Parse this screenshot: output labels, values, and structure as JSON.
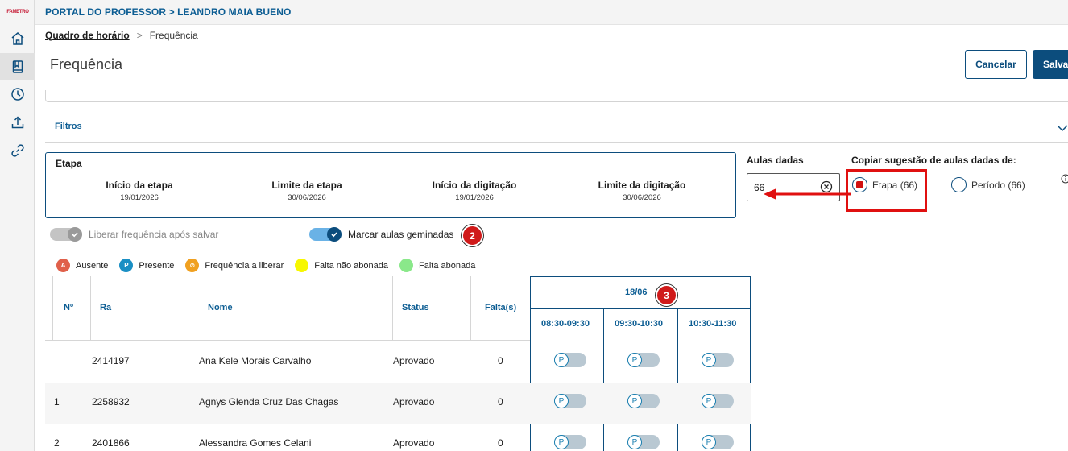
{
  "app": {
    "logo_text": "FAMETRO",
    "header_title": "PORTAL DO PROFESSOR > LEANDRO MAIA BUENO"
  },
  "sidebar": {
    "items": [
      {
        "name": "home-icon",
        "active": false
      },
      {
        "name": "book-icon",
        "active": true
      },
      {
        "name": "clock-icon",
        "active": false
      },
      {
        "name": "upload-icon",
        "active": false
      },
      {
        "name": "link-icon",
        "active": false
      }
    ]
  },
  "breadcrumb": {
    "link": "Quadro de horário",
    "separator": ">",
    "current": "Frequência"
  },
  "page": {
    "title": "Frequência",
    "cancel_label": "Cancelar",
    "save_label": "Salva"
  },
  "filters": {
    "label": "Filtros"
  },
  "etapa": {
    "title": "Etapa",
    "columns": [
      {
        "label": "Início da etapa",
        "value": "19/01/2026"
      },
      {
        "label": "Limite da etapa",
        "value": "30/06/2026"
      },
      {
        "label": "Início da digitação",
        "value": "19/01/2026"
      },
      {
        "label": "Limite da digitação",
        "value": "30/06/2026"
      }
    ]
  },
  "aulas_dadas": {
    "label": "Aulas dadas",
    "value": "66"
  },
  "copiar": {
    "label": "Copiar sugestão de aulas dadas de:",
    "options": [
      {
        "label": "Etapa (66)",
        "checked": true
      },
      {
        "label": "Período (66)",
        "checked": false
      }
    ]
  },
  "toggles": {
    "liberar": {
      "label": "Liberar frequência após salvar",
      "on": false
    },
    "marcar": {
      "label": "Marcar aulas geminadas",
      "on": true
    }
  },
  "badges": {
    "step2": "2",
    "step3": "3"
  },
  "legend": [
    {
      "letter": "A",
      "label": "Ausente",
      "color": "#e0604a"
    },
    {
      "letter": "P",
      "label": "Presente",
      "color": "#1a8fc4"
    },
    {
      "letter": "⊘",
      "label": "Frequência a liberar",
      "color": "#f0a020"
    },
    {
      "letter": "",
      "label": "Falta não abonada",
      "color": "#f7f700"
    },
    {
      "letter": "",
      "label": "Falta abonada",
      "color": "#8ae88a"
    }
  ],
  "table": {
    "headers": {
      "num": "Nº",
      "ra": "Ra",
      "nome": "Nome",
      "status": "Status",
      "faltas": "Falta(s)"
    },
    "date": "18/06",
    "slots": [
      "08:30-09:30",
      "09:30-10:30",
      "10:30-11:30"
    ],
    "presence_letter": "P",
    "rows": [
      {
        "num": "",
        "ra": "2414197",
        "nome": "Ana Kele Morais Carvalho",
        "status": "Aprovado",
        "faltas": "0"
      },
      {
        "num": "1",
        "ra": "2258932",
        "nome": "Agnys Glenda Cruz Das Chagas",
        "status": "Aprovado",
        "faltas": "0"
      },
      {
        "num": "2",
        "ra": "2401866",
        "nome": "Alessandra Gomes Celani",
        "status": "Aprovado",
        "faltas": "0"
      }
    ]
  },
  "colors": {
    "primary": "#0c4d7d",
    "link": "#0c5d93",
    "highlight": "#e01010"
  }
}
